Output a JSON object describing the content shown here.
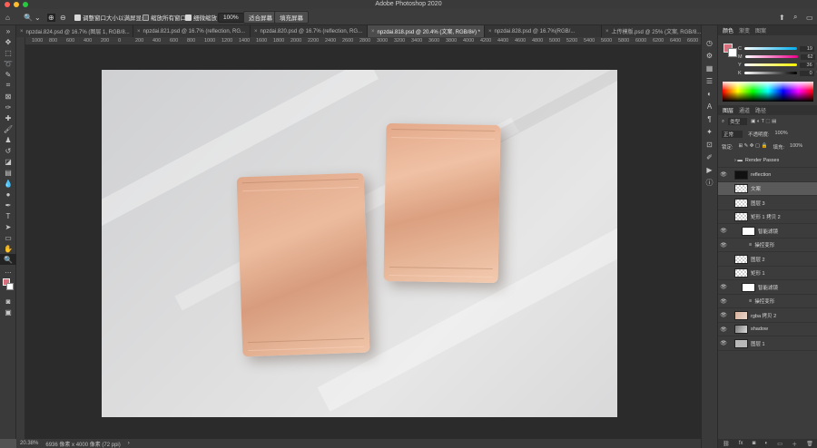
{
  "window": {
    "title": "Adobe Photoshop 2020",
    "traffic_lights": [
      "#ff5f57",
      "#febc2e",
      "#28c840"
    ]
  },
  "options_bar": {
    "resize_windows_label": "调整窗口大小以满屏显示",
    "zoom_all_windows_label": "缩放所有窗口",
    "scrubby_zoom_label": "细微缩放",
    "zoom_value": "100%",
    "fit_screen_label": "适合屏幕",
    "fill_screen_label": "填充屏幕"
  },
  "tabs": [
    {
      "label": "npzdai.824.psd @ 16.7% (图层 1, RGB/8...",
      "active": false
    },
    {
      "label": "npzdai.821.psd @ 16.7% (reflection, RG...",
      "active": false
    },
    {
      "label": "npzdai.820.psd @ 16.7% (reflection, RG...",
      "active": false
    },
    {
      "label": "npzdai.818.psd @ 20.4% (文案, RGB/8#) *",
      "active": true
    },
    {
      "label": "npzdai.828.psd @ 16.7%(RGB/...",
      "active": false
    },
    {
      "label": "上传模版.psd @ 25% (文案, RGB/8...",
      "active": false
    }
  ],
  "ruler_ticks": [
    "1200",
    "1000",
    "800",
    "600",
    "400",
    "200",
    "0",
    "200",
    "400",
    "600",
    "800",
    "1000",
    "1200",
    "1400",
    "1600",
    "1800",
    "2000",
    "2200",
    "2400",
    "2600",
    "2800",
    "3000",
    "3200",
    "3400",
    "3600",
    "3800",
    "4000",
    "4200",
    "4400",
    "4600",
    "4800",
    "5000",
    "5200",
    "5400",
    "5600",
    "5800",
    "6000",
    "6200",
    "6400",
    "6600",
    "6800",
    "7000",
    "7200",
    "7400",
    "7600",
    "7800"
  ],
  "status": {
    "zoom": "20.38%",
    "doc_size": "6936 像素 x 4000 像素 (72 ppi)"
  },
  "color_panel": {
    "tabs": [
      "颜色",
      "渐变",
      "图案"
    ],
    "foreground": "#d7707c",
    "channels": [
      {
        "label": "C",
        "value": "19",
        "unit": "%"
      },
      {
        "label": "M",
        "value": "62",
        "unit": "%"
      },
      {
        "label": "Y",
        "value": "36",
        "unit": "%"
      },
      {
        "label": "K",
        "value": "0",
        "unit": "%"
      }
    ]
  },
  "layers_panel": {
    "tabs": [
      "图层",
      "通道",
      "路径"
    ],
    "filter_kind": "类型",
    "blend_mode": "正常",
    "opacity_label": "不透明度:",
    "opacity": "100%",
    "lock_label": "锁定:",
    "fill_label": "填充:",
    "fill": "100%",
    "layers": [
      {
        "name": "Render Passes",
        "type": "group",
        "visible": false,
        "selected": false,
        "indent": 0
      },
      {
        "name": "reflection",
        "type": "black",
        "visible": true,
        "selected": false,
        "indent": 0
      },
      {
        "name": "文案",
        "type": "check",
        "visible": false,
        "selected": true,
        "indent": 0
      },
      {
        "name": "图层 3",
        "type": "check",
        "visible": false,
        "selected": false,
        "indent": 0
      },
      {
        "name": "矩形 1 拷贝 2",
        "type": "check",
        "visible": false,
        "selected": false,
        "indent": 0
      },
      {
        "name": "智能滤镜",
        "type": "white",
        "visible": true,
        "selected": false,
        "indent": 1
      },
      {
        "name": "操控变形",
        "type": "none",
        "visible": true,
        "selected": false,
        "indent": 2
      },
      {
        "name": "图层 2",
        "type": "check",
        "visible": false,
        "selected": false,
        "indent": 0
      },
      {
        "name": "矩形 1",
        "type": "check",
        "visible": false,
        "selected": false,
        "indent": 0
      },
      {
        "name": "智能滤镜",
        "type": "white",
        "visible": true,
        "selected": false,
        "indent": 1
      },
      {
        "name": "操控变形",
        "type": "none",
        "visible": true,
        "selected": false,
        "indent": 2
      },
      {
        "name": "rgba 拷贝 2",
        "type": "photo",
        "visible": true,
        "selected": false,
        "indent": 0
      },
      {
        "name": "shadow",
        "type": "shadow",
        "visible": true,
        "selected": false,
        "indent": 0
      },
      {
        "name": "图层 1",
        "type": "gray",
        "visible": true,
        "selected": false,
        "indent": 0
      }
    ]
  }
}
